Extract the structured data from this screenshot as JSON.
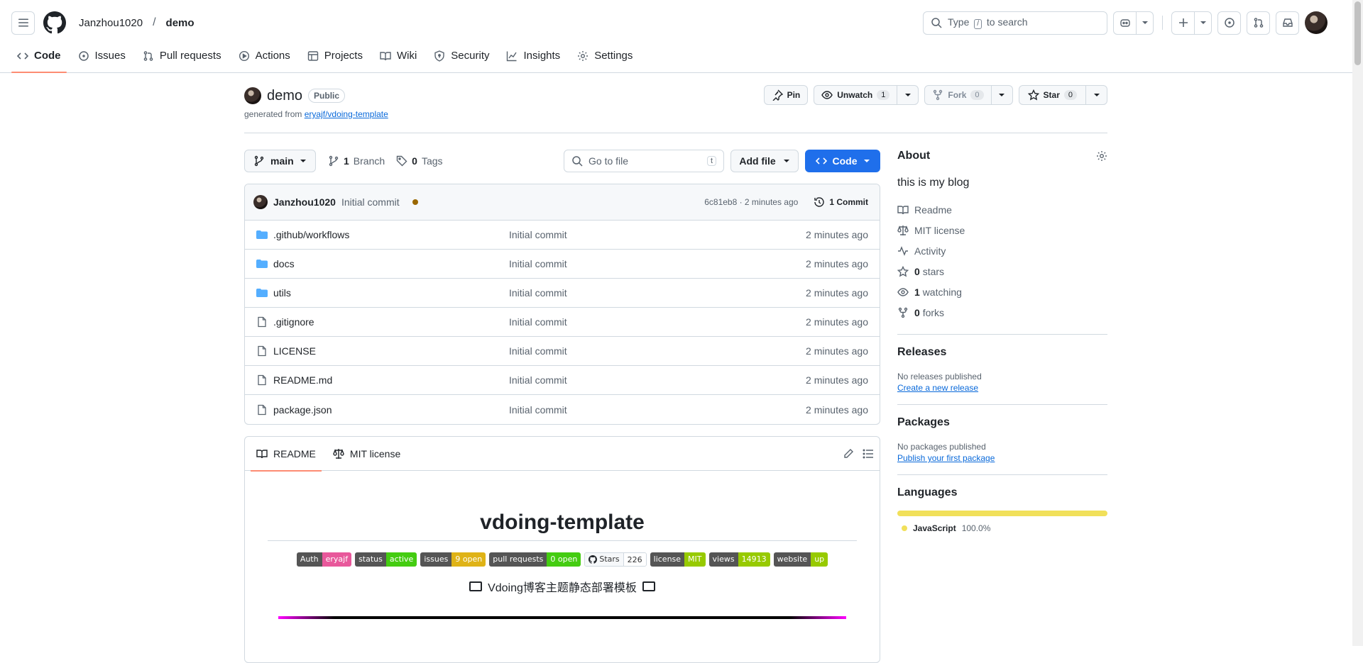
{
  "header": {
    "owner": "Janzhou1020",
    "separator": "/",
    "repo": "demo",
    "search_pre": "Type",
    "search_key": "/",
    "search_post": "to search"
  },
  "nav": {
    "tabs": [
      {
        "label": "Code"
      },
      {
        "label": "Issues"
      },
      {
        "label": "Pull requests"
      },
      {
        "label": "Actions"
      },
      {
        "label": "Projects"
      },
      {
        "label": "Wiki"
      },
      {
        "label": "Security"
      },
      {
        "label": "Insights"
      },
      {
        "label": "Settings"
      }
    ]
  },
  "repo": {
    "name": "demo",
    "visibility": "Public",
    "generated_from_label": "generated from",
    "template_link": "eryajf/vdoing-template",
    "pin_label": "Pin",
    "unwatch_label": "Unwatch",
    "watch_count": "1",
    "fork_label": "Fork",
    "fork_count": "0",
    "star_label": "Star",
    "star_count": "0"
  },
  "toolbar": {
    "branch": "main",
    "branches_count": "1",
    "branches_label": "Branch",
    "tags_count": "0",
    "tags_label": "Tags",
    "goto_placeholder": "Go to file",
    "goto_key": "t",
    "add_file_label": "Add file",
    "code_label": "Code"
  },
  "commit": {
    "author": "Janzhou1020",
    "message": "Initial commit",
    "meta": "6c81eb8 · 2 minutes ago",
    "commits_label": "1 Commit"
  },
  "files": [
    {
      "name": ".github/workflows",
      "type": "dir",
      "message": "Initial commit",
      "time": "2 minutes ago"
    },
    {
      "name": "docs",
      "type": "dir",
      "message": "Initial commit",
      "time": "2 minutes ago"
    },
    {
      "name": "utils",
      "type": "dir",
      "message": "Initial commit",
      "time": "2 minutes ago"
    },
    {
      "name": ".gitignore",
      "type": "file",
      "message": "Initial commit",
      "time": "2 minutes ago"
    },
    {
      "name": "LICENSE",
      "type": "file",
      "message": "Initial commit",
      "time": "2 minutes ago"
    },
    {
      "name": "README.md",
      "type": "file",
      "message": "Initial commit",
      "time": "2 minutes ago"
    },
    {
      "name": "package.json",
      "type": "file",
      "message": "Initial commit",
      "time": "2 minutes ago"
    }
  ],
  "readme": {
    "tab_readme": "README",
    "tab_license": "MIT license",
    "title": "vdoing-template",
    "tagline": "Vdoing博客主题静态部署模板",
    "shields": [
      {
        "key": "Auth",
        "value": "eryajf",
        "color": "#e8589b"
      },
      {
        "key": "status",
        "value": "active",
        "color": "#4c1"
      },
      {
        "key": "issues",
        "value": "9 open",
        "color": "#dfb317"
      },
      {
        "key": "pull requests",
        "value": "0 open",
        "color": "#4c1"
      },
      {
        "key": "Stars",
        "value": "226",
        "color": "#fff"
      },
      {
        "key": "license",
        "value": "MIT",
        "color": "#97ca00"
      },
      {
        "key": "views",
        "value": "14913",
        "color": "#97ca00"
      },
      {
        "key": "website",
        "value": "up",
        "color": "#97ca00"
      }
    ]
  },
  "about": {
    "title": "About",
    "description": "this is my blog",
    "items": [
      {
        "icon": "book-icon",
        "count": "",
        "label": "Readme"
      },
      {
        "icon": "law-icon",
        "count": "",
        "label": "MIT license"
      },
      {
        "icon": "pulse-icon",
        "count": "",
        "label": "Activity"
      },
      {
        "icon": "star-icon",
        "count": "0",
        "label": "stars"
      },
      {
        "icon": "eye-icon",
        "count": "1",
        "label": "watching"
      },
      {
        "icon": "fork-icon",
        "count": "0",
        "label": "forks"
      }
    ]
  },
  "releases": {
    "title": "Releases",
    "empty": "No releases published",
    "link": "Create a new release"
  },
  "packages": {
    "title": "Packages",
    "empty": "No packages published",
    "link": "Publish your first package"
  },
  "languages": {
    "title": "Languages",
    "items": [
      {
        "name": "JavaScript",
        "percent": "100.0%",
        "color": "#f1e05a"
      }
    ]
  }
}
